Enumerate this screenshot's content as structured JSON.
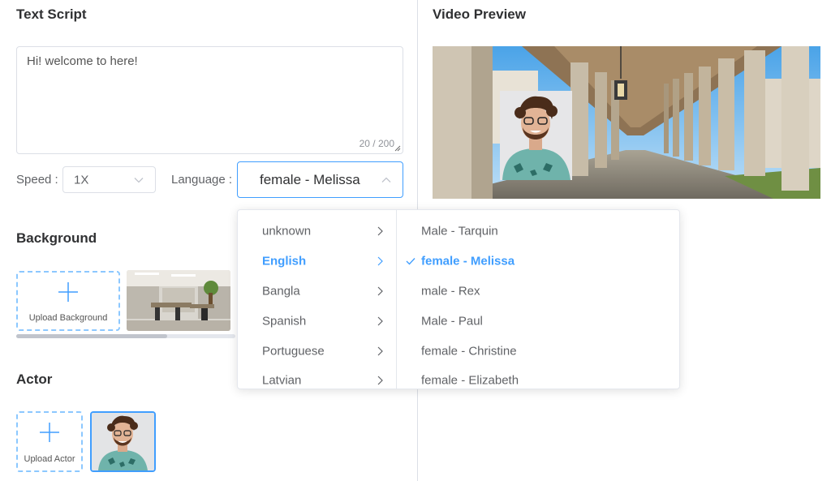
{
  "text_script": {
    "title": "Text Script",
    "content": "Hi! welcome to here!",
    "count": "20 / 200"
  },
  "speed": {
    "label": "Speed :",
    "value": "1X"
  },
  "language": {
    "label": "Language :",
    "value": "female - Melissa"
  },
  "background": {
    "title": "Background",
    "upload_label": "Upload Background"
  },
  "actor": {
    "title": "Actor",
    "upload_label": "Upload Actor"
  },
  "video_preview": {
    "title": "Video Preview"
  },
  "cascader": {
    "languages": [
      "unknown",
      "English",
      "Bangla",
      "Spanish",
      "Portuguese",
      "Latvian"
    ],
    "selected_language": "English",
    "voices": [
      "Male - Tarquin",
      "female - Melissa",
      "male - Rex",
      "Male - Paul",
      "female - Christine",
      "female - Elizabeth"
    ],
    "selected_voice": "female - Melissa"
  },
  "colors": {
    "accent": "#409eff",
    "border": "#dcdfe6",
    "dashed": "#8cc8ff"
  }
}
